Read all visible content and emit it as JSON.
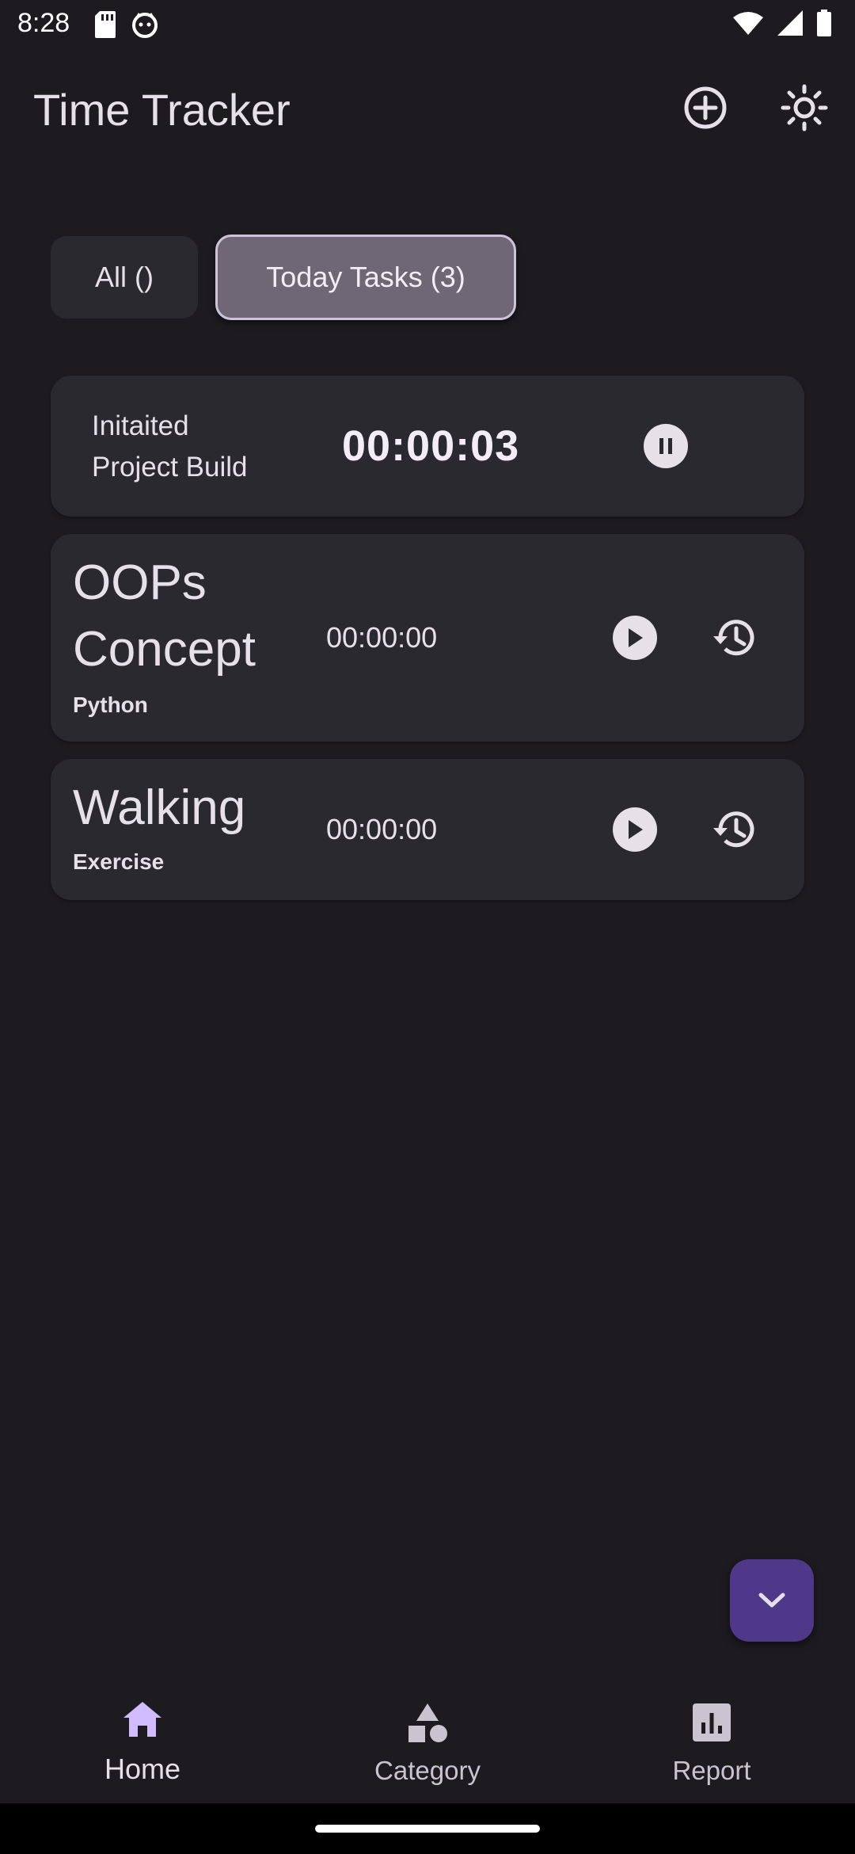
{
  "status_bar": {
    "time": "8:28",
    "icons": [
      "sd-card-icon",
      "cat-icon",
      "wifi-icon",
      "signal-icon",
      "battery-icon"
    ]
  },
  "app_bar": {
    "title": "Time Tracker",
    "actions": [
      "add-circle-icon",
      "brightness-icon"
    ]
  },
  "filters": {
    "all_label": "All ()",
    "today_label": "Today Tasks (3)",
    "selected": "today"
  },
  "active_task": {
    "name": "Initaited Project Build",
    "elapsed": "00:00:03",
    "action_icon": "pause-icon"
  },
  "tasks": [
    {
      "name": "OOPs Concept",
      "category": "Python",
      "elapsed": "00:00:00"
    },
    {
      "name": "Walking",
      "category": "Exercise",
      "elapsed": "00:00:00"
    }
  ],
  "fab": {
    "icon": "chevron-down-icon"
  },
  "bottom_nav": {
    "items": [
      {
        "label": "Home",
        "icon": "home-icon",
        "selected": true
      },
      {
        "label": "Category",
        "icon": "category-icon",
        "selected": false
      },
      {
        "label": "Report",
        "icon": "report-icon",
        "selected": false
      }
    ]
  },
  "colors": {
    "background": "#1d1b20",
    "card": "#2b2930",
    "chip_selected": "#6f6676",
    "fab": "#4f378a",
    "on_surface": "#e6e0e9"
  }
}
